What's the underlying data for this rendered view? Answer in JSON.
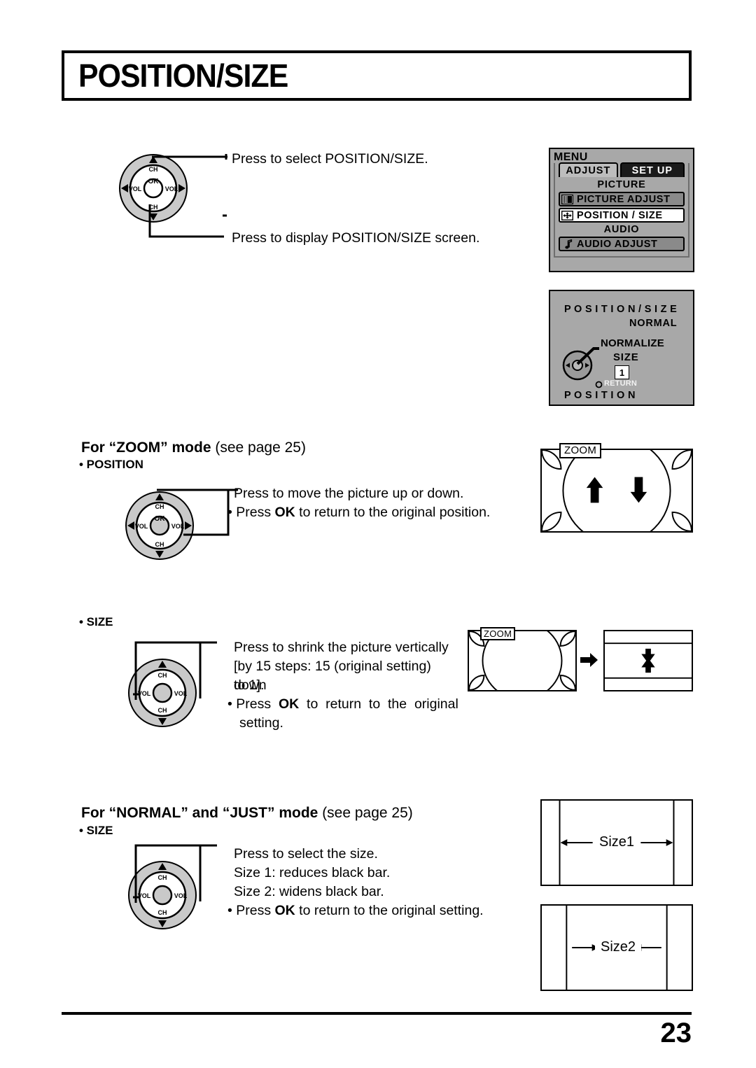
{
  "page": {
    "title": "POSITION/SIZE",
    "number": "23"
  },
  "steps": [
    {
      "text": "Press to select POSITION/SIZE."
    },
    {
      "text": "Press to display POSITION/SIZE screen."
    }
  ],
  "dial": {
    "ok": "OK",
    "ch_up": "CH",
    "ch_down": "CH",
    "vol_left": "VOL",
    "vol_right": "VOL"
  },
  "osd_menu": {
    "title": "MENU",
    "tabs": [
      {
        "label": "ADJUST",
        "active": true
      },
      {
        "label": "SET UP",
        "active": false
      }
    ],
    "groups": [
      {
        "label": "PICTURE",
        "items": [
          {
            "label": "PICTURE  ADJUST",
            "icon": "picture-bars-icon",
            "selected": false
          },
          {
            "label": "POSITION / SIZE",
            "icon": "four-way-arrow-icon",
            "selected": true
          }
        ]
      },
      {
        "label": "AUDIO",
        "items": [
          {
            "label": "AUDIO  ADJUST",
            "icon": "music-note-icon",
            "selected": false
          }
        ]
      }
    ]
  },
  "osd_possize": {
    "heading": "P O S I T I O N / S I Z E",
    "mode": "NORMAL",
    "normalize": "NORMALIZE",
    "size_label": "SIZE",
    "size_value": "1",
    "return_label": "RETURN",
    "position_label": "P O S I T I O N"
  },
  "zoom_section": {
    "heading_bold": "For “ZOOM”  mode",
    "heading_note": "(see page 25)",
    "position_sub": "• POSITION",
    "position_lines": [
      "Press to move the picture up or down.",
      "• Press OK to return to the original position."
    ],
    "size_sub": "• SIZE",
    "size_lines": [
      "Press to shrink the picture vertically",
      "[by 15 steps: 15 (original setting) down",
      "to 1].",
      "• Press  OK  to return to the original",
      "setting."
    ],
    "tv_tag": "ZOOM"
  },
  "normal_section": {
    "heading_bold": "For “NORMAL” and “JUST” mode",
    "heading_note": "(see page 25)",
    "size_sub": "• SIZE",
    "lines": [
      "Press to select the size.",
      "Size 1: reduces black bar.",
      "Size 2: widens black bar.",
      "• Press OK to return to the original setting."
    ],
    "size1_label": "Size1",
    "size2_label": "Size2"
  },
  "colors": {
    "osd_background": "#a8a8a8",
    "osd_item_dark": "#8a8a8a",
    "osd_item_selected": "#ffffff",
    "tab_inactive": "#1a1a1a",
    "dial_gray": "#c9c9c9",
    "ink": "#000000"
  }
}
